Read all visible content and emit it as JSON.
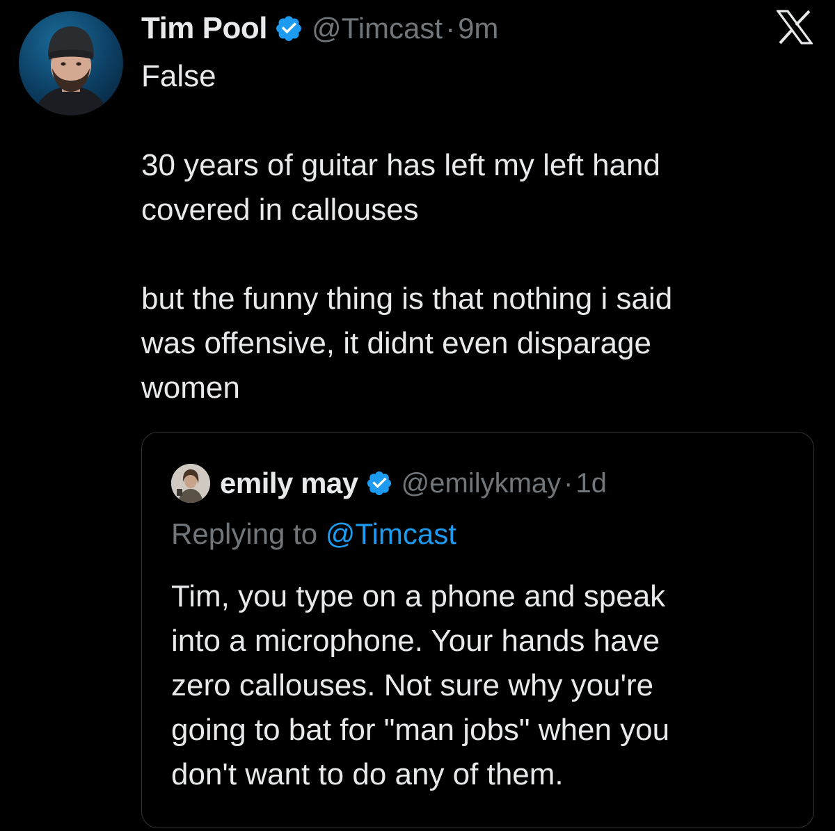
{
  "colors": {
    "background": "#000000",
    "text": "#e7e9ea",
    "muted": "#71767b",
    "accent": "#1d9bf0",
    "border": "#2f3336"
  },
  "app": {
    "logo_icon": "x-logo-icon"
  },
  "tweet": {
    "display_name": "Tim Pool",
    "verified_icon": "verified-badge-icon",
    "handle": "@Timcast",
    "separator": "·",
    "time": "9m",
    "lines": [
      "False",
      "",
      "30 years of guitar has left my left hand",
      "covered in callouses",
      "",
      "but the funny thing is that nothing i said",
      "was offensive, it didnt even disparage",
      "women"
    ]
  },
  "quoted_tweet": {
    "display_name": "emily may",
    "verified_icon": "verified-badge-icon",
    "handle": "@emilykmay",
    "separator": "·",
    "time": "1d",
    "replying_prefix": "Replying to ",
    "replying_to": "@Timcast",
    "lines": [
      "Tim, you type on a phone and speak",
      "into a microphone. Your hands have",
      "zero callouses. Not sure why you're",
      "going to bat for \"man jobs\" when you",
      "don't want to do any of them."
    ]
  }
}
